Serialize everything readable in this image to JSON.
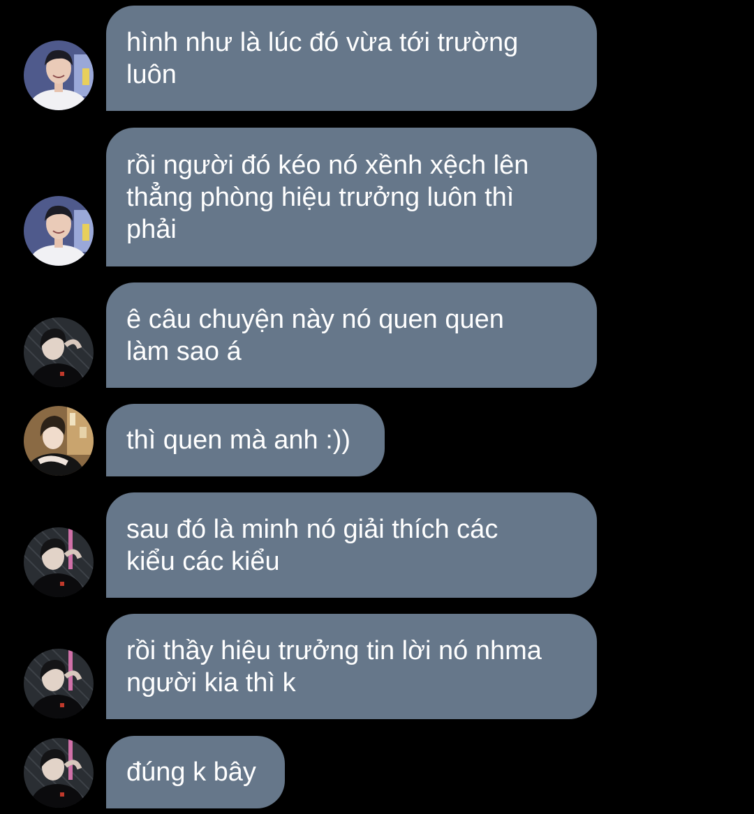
{
  "messages": [
    {
      "sender": "boy-avatar",
      "text": "hình như là lúc đó vừa tới trường\nluôn"
    },
    {
      "sender": "boy-avatar",
      "text": "rồi người đó kéo nó xềnh xệch lên\nthẳng phòng hiệu trưởng luôn thì\nphải"
    },
    {
      "sender": "dark-avatar",
      "text": "ê câu chuyện này nó quen quen\nlàm sao á"
    },
    {
      "sender": "cafe-avatar",
      "text": "thì quen mà anh :))"
    },
    {
      "sender": "dark-avatar",
      "text": "sau đó là minh nó giải thích các\nkiểu các kiểu"
    },
    {
      "sender": "dark-avatar",
      "text": "rồi thầy hiệu trưởng tin lời nó nhma\nngười kia thì k"
    },
    {
      "sender": "dark-avatar",
      "text": "đúng k bây"
    }
  ],
  "colors": {
    "background": "#000000",
    "bubble": "#66778a",
    "text": "#ffffff"
  }
}
